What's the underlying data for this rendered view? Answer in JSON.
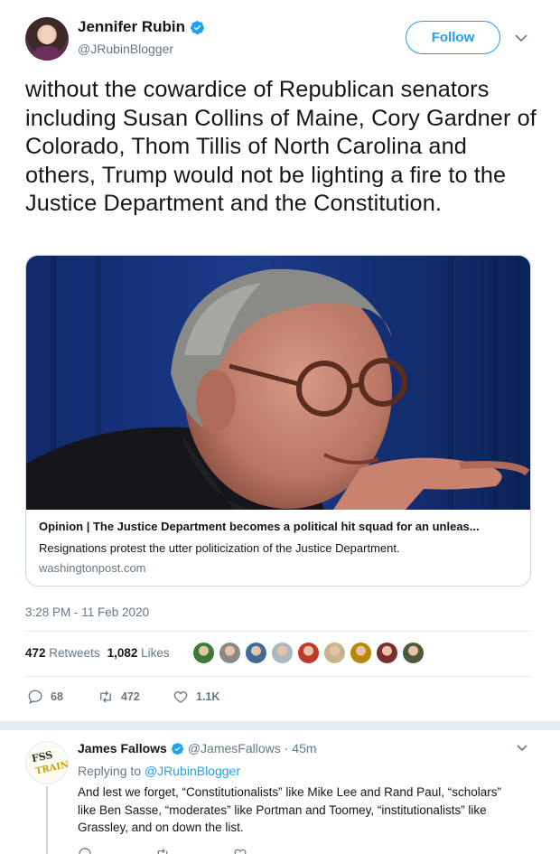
{
  "author": {
    "name": "Jennifer Rubin",
    "handle": "@JRubinBlogger",
    "verified": true
  },
  "follow_label": "Follow",
  "tweet_text": "without the cowardice of Republican senators including Susan Collins of Maine, Cory Gardner of Colorado, Thom Tillis of North Carolina and others, Trump would not be lighting a fire to the Justice Department and the Constitution.",
  "card": {
    "title": "Opinion | The Justice Department becomes a political hit squad for an unleas...",
    "description": "Resignations protest the utter politicization of the Justice Department.",
    "domain": "washingtonpost.com"
  },
  "timestamp": "3:28 PM - 11 Feb 2020",
  "stats": {
    "retweets_count": "472",
    "retweets_label": "Retweets",
    "likes_count": "1,082",
    "likes_label": "Likes"
  },
  "likers": [
    "#3a7d3a",
    "#8a8a8a",
    "#3d6b9a",
    "#aab8c2",
    "#c0392b",
    "#c9b58c",
    "#b8860b",
    "#7a2e2e",
    "#4d5a3a"
  ],
  "actions": {
    "replies": "68",
    "retweets": "472",
    "likes": "1.1K"
  },
  "reply": {
    "name": "James Fallows",
    "handle": "@JamesFallows",
    "time": "· 45m",
    "replying_prefix": "Replying to",
    "replying_to": "@JRubinBlogger",
    "text": "And lest we forget, “Constitutionalists” like Mike Lee and Rand Paul, “scholars” like Ben Sasse, “moderates” like Portman and Toomey, “institutionalists” like Grassley, and on down the list.",
    "avatar_text_1": "FSS",
    "avatar_text_2": "TRAINS"
  },
  "colors": {
    "accent": "#1da1f2",
    "muted": "#657786",
    "text": "#14171a"
  },
  "icons": [
    "verified-badge-icon",
    "chevron-down-icon",
    "reply-icon",
    "retweet-icon",
    "heart-icon"
  ]
}
